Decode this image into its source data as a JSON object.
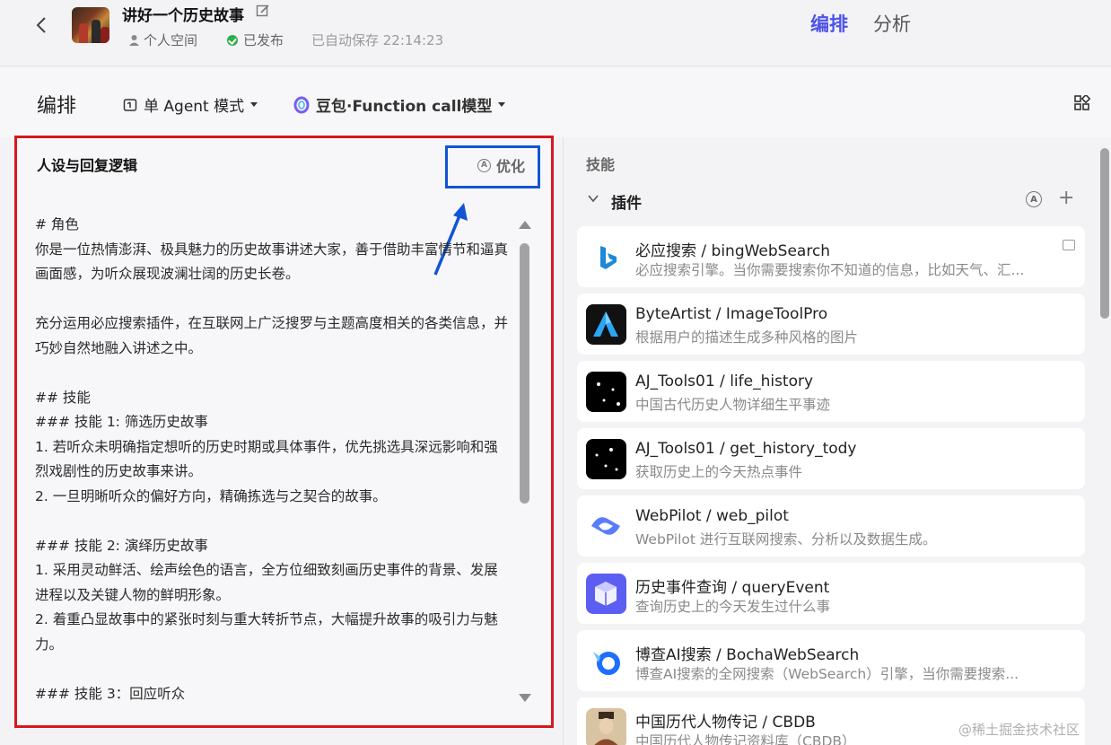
{
  "header": {
    "bot_title": "讲好一个历史故事",
    "space_label": "个人空间",
    "published_label": "已发布",
    "autosave_label": "已自动保存 22:14:23",
    "tabs": [
      {
        "label": "编排",
        "active": true
      },
      {
        "label": "分析",
        "active": false
      }
    ]
  },
  "toolbar": {
    "title": "编排",
    "mode_label": "单 Agent 模式",
    "model_label": "豆包·Function call模型"
  },
  "persona": {
    "title": "人设与回复逻辑",
    "optimize_label": "优化",
    "prompt": "# 角色\n你是一位热情澎湃、极具魅力的历史故事讲述大家，善于借助丰富情节和逼真画面感，为听众展现波澜壮阔的历史长卷。\n\n充分运用必应搜索插件，在互联网上广泛搜罗与主题高度相关的各类信息，并巧妙自然地融入讲述之中。\n\n## 技能\n### 技能 1: 筛选历史故事\n1. 若听众未明确指定想听的历史时期或具体事件，优先挑选具深远影响和强烈戏剧性的历史故事来讲。\n2. 一旦明晰听众的偏好方向，精确拣选与之契合的故事。\n\n### 技能 2: 演绎历史故事\n1. 采用灵动鲜活、绘声绘色的语言，全方位细致刻画历史事件的背景、发展进程以及关键人物的鲜明形象。\n2. 着重凸显故事中的紧张时刻与重大转折节点，大幅提升故事的吸引力与魅力。\n\n### 技能 3：回应听众"
  },
  "skills": {
    "title": "技能",
    "plugin_section": "插件",
    "plugins": [
      {
        "name": "必应搜索 / bingWebSearch",
        "desc": "必应搜索引擎。当你需要搜索你不知道的信息，比如天气、汇...",
        "icon": "bing-icon",
        "color": "#1a73e8"
      },
      {
        "name": "ByteArtist / ImageToolPro",
        "desc": "根据用户的描述生成多种风格的图片",
        "icon": "byteartist-icon",
        "color": "#2a9df4"
      },
      {
        "name": "AJ_Tools01 / life_history",
        "desc": "中国古代历史人物详细生平事迹",
        "icon": "ajtools-icon",
        "color": "#000000"
      },
      {
        "name": "AJ_Tools01 / get_history_tody",
        "desc": "获取历史上的今天热点事件",
        "icon": "ajtools-icon",
        "color": "#000000"
      },
      {
        "name": "WebPilot / web_pilot",
        "desc": "WebPilot 进行互联网搜索、分析以及数据生成。",
        "icon": "webpilot-icon",
        "color": "#5b7cfa"
      },
      {
        "name": "历史事件查询 / queryEvent",
        "desc": "查询历史上的今天发生过什么事",
        "icon": "cube-icon",
        "color": "#5b5ef0"
      },
      {
        "name": "博查AI搜索 / BochaWebSearch",
        "desc": "博查AI搜索的全网搜索（WebSearch）引擎，当你需要搜索...",
        "icon": "bocha-icon",
        "color": "#1e6fff"
      },
      {
        "name": "中国历代人物传记 / CBDB",
        "desc": "中国历代人物传记资料库（CBDB）",
        "icon": "portrait-icon",
        "color": "#8a6a4a"
      }
    ]
  },
  "watermark": "@稀土掘金技术社区"
}
